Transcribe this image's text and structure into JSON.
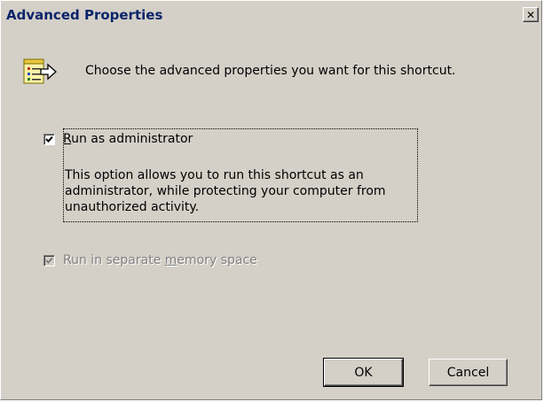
{
  "window": {
    "title": "Advanced Properties",
    "close_glyph": "✕"
  },
  "header": {
    "icon": "properties-arrow-icon",
    "text": "Choose the advanced properties you want for this shortcut."
  },
  "options": {
    "run_as_admin": {
      "label_mnemonic": "R",
      "label_rest": "un as administrator",
      "checked": true,
      "enabled": true,
      "description": "This option allows you to run this shortcut as an administrator, while protecting your computer from unauthorized activity."
    },
    "separate_memory": {
      "label_before": "Run in separate ",
      "label_mnemonic": "m",
      "label_after": "emory space",
      "checked": true,
      "enabled": false
    }
  },
  "buttons": {
    "ok": "OK",
    "cancel": "Cancel"
  },
  "colors": {
    "dialog_bg": "#d4d0c8",
    "title_text": "#0a246a",
    "disabled_text": "#808080"
  }
}
